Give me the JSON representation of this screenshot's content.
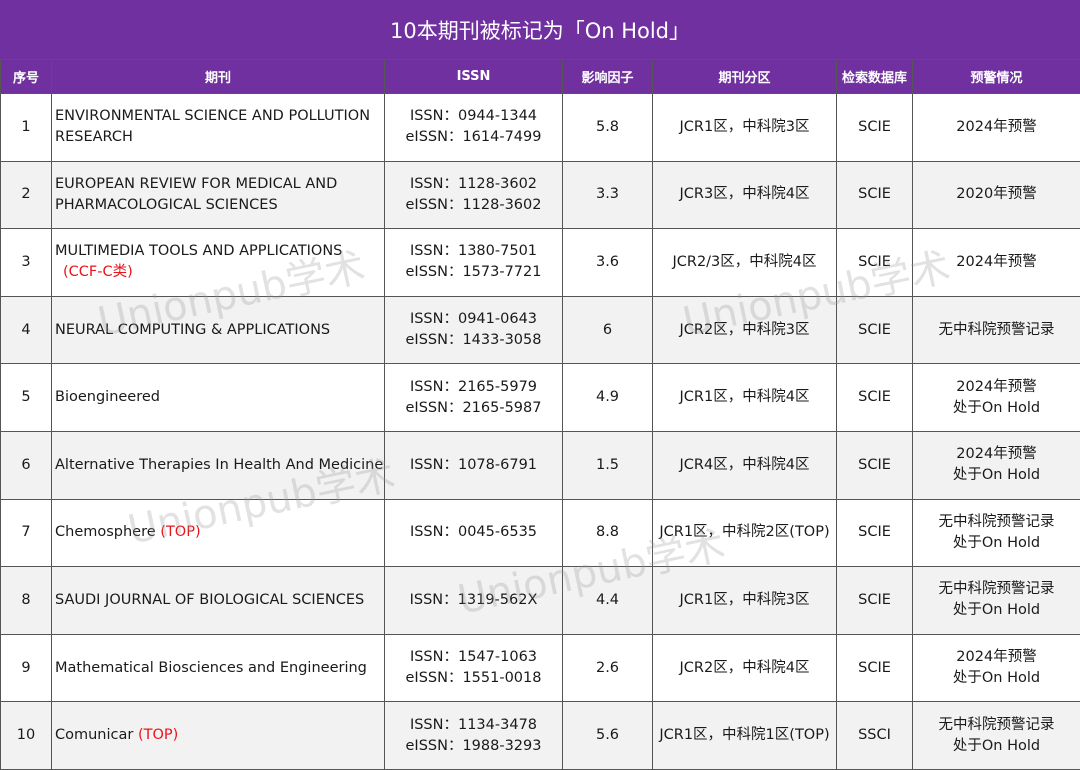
{
  "title": "10本期刊被标记为「On Hold」",
  "headers": {
    "index": "序号",
    "journal": "期刊",
    "issn": "ISSN",
    "impact": "影响因子",
    "partition": "期刊分区",
    "database": "检索数据库",
    "warning": "预警情况"
  },
  "watermark": "Unionpub学术",
  "rows": [
    {
      "index": "1",
      "journal": "ENVIRONMENTAL SCIENCE AND POLLUTION RESEARCH",
      "tag": "",
      "issn": "ISSN：0944-1344",
      "eissn": "eISSN：1614-7499",
      "impact": "5.8",
      "partition": "JCR1区，中科院3区",
      "database": "SCIE",
      "warning1": "2024年预警",
      "warning2": ""
    },
    {
      "index": "2",
      "journal": "EUROPEAN REVIEW FOR MEDICAL AND PHARMACOLOGICAL SCIENCES",
      "tag": "",
      "issn": "ISSN：1128-3602",
      "eissn": "eISSN：1128-3602",
      "impact": "3.3",
      "partition": "JCR3区，中科院4区",
      "database": "SCIE",
      "warning1": "2020年预警",
      "warning2": ""
    },
    {
      "index": "3",
      "journal": "MULTIMEDIA TOOLS AND APPLICATIONS",
      "tag": "(CCF-C类)",
      "issn": "ISSN：1380-7501",
      "eissn": "eISSN：1573-7721",
      "impact": "3.6",
      "partition": "JCR2/3区，中科院4区",
      "database": "SCIE",
      "warning1": "2024年预警",
      "warning2": ""
    },
    {
      "index": "4",
      "journal": "NEURAL COMPUTING & APPLICATIONS",
      "tag": "",
      "issn": "ISSN：0941-0643",
      "eissn": "eISSN：1433-3058",
      "impact": "6",
      "partition": "JCR2区，中科院3区",
      "database": "SCIE",
      "warning1": "无中科院预警记录",
      "warning2": ""
    },
    {
      "index": "5",
      "journal": "Bioengineered",
      "tag": "",
      "issn": "ISSN：2165-5979",
      "eissn": "eISSN：2165-5987",
      "impact": "4.9",
      "partition": "JCR1区，中科院4区",
      "database": "SCIE",
      "warning1": "2024年预警",
      "warning2": "处于On Hold"
    },
    {
      "index": "6",
      "journal": "Alternative Therapies In Health And Medicine",
      "tag": "",
      "issn": "ISSN：1078-6791",
      "eissn": "",
      "impact": "1.5",
      "partition": "JCR4区，中科院4区",
      "database": "SCIE",
      "warning1": "2024年预警",
      "warning2": "处于On Hold"
    },
    {
      "index": "7",
      "journal": "Chemosphere",
      "tag": "(TOP)",
      "issn": "ISSN：0045-6535",
      "eissn": "",
      "impact": "8.8",
      "partition": "JCR1区，中科院2区(TOP)",
      "database": "SCIE",
      "warning1": "无中科院预警记录",
      "warning2": "处于On Hold"
    },
    {
      "index": "8",
      "journal": "SAUDI JOURNAL OF BIOLOGICAL SCIENCES",
      "tag": "",
      "issn": "ISSN：1319-562X",
      "eissn": "",
      "impact": "4.4",
      "partition": "JCR1区，中科院3区",
      "database": "SCIE",
      "warning1": "无中科院预警记录",
      "warning2": "处于On Hold"
    },
    {
      "index": "9",
      "journal": "Mathematical Biosciences and Engineering",
      "tag": "",
      "issn": "ISSN：1547-1063",
      "eissn": "eISSN：1551-0018",
      "impact": "2.6",
      "partition": "JCR2区，中科院4区",
      "database": "SCIE",
      "warning1": "2024年预警",
      "warning2": "处于On Hold"
    },
    {
      "index": "10",
      "journal": "Comunicar",
      "tag": "(TOP)",
      "issn": "ISSN：1134-3478",
      "eissn": "eISSN：1988-3293",
      "impact": "5.6",
      "partition": "JCR1区，中科院1区(TOP)",
      "database": "SSCI",
      "warning1": "无中科院预警记录",
      "warning2": "处于On Hold"
    }
  ]
}
